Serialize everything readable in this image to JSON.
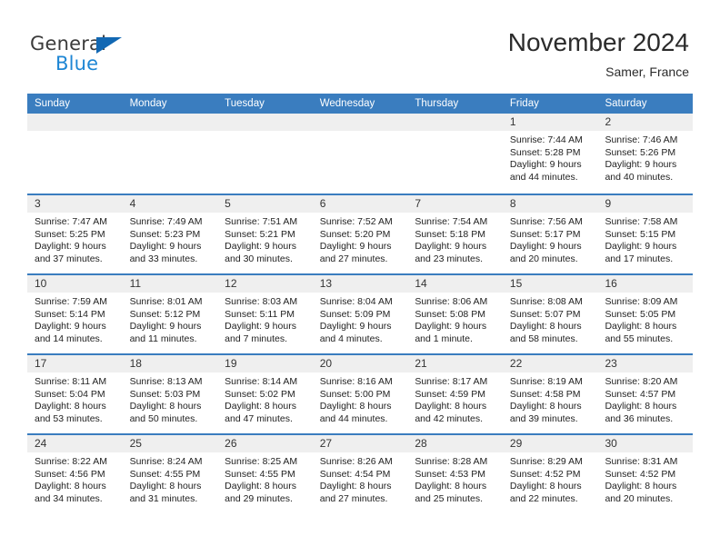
{
  "brand": {
    "name_part1": "General",
    "name_part2": "Blue",
    "triangle_color": "#1268b3",
    "blue_color": "#1e86d4"
  },
  "header": {
    "month_title": "November 2024",
    "location": "Samer, France"
  },
  "theme": {
    "header_blue": "#3a7dbf",
    "daynum_band": "#efefef",
    "text": "#222222"
  },
  "weekdays": [
    "Sunday",
    "Monday",
    "Tuesday",
    "Wednesday",
    "Thursday",
    "Friday",
    "Saturday"
  ],
  "weeks": [
    [
      {
        "day": "",
        "lines": []
      },
      {
        "day": "",
        "lines": []
      },
      {
        "day": "",
        "lines": []
      },
      {
        "day": "",
        "lines": []
      },
      {
        "day": "",
        "lines": []
      },
      {
        "day": "1",
        "lines": [
          "Sunrise: 7:44 AM",
          "Sunset: 5:28 PM",
          "Daylight: 9 hours",
          "and 44 minutes."
        ]
      },
      {
        "day": "2",
        "lines": [
          "Sunrise: 7:46 AM",
          "Sunset: 5:26 PM",
          "Daylight: 9 hours",
          "and 40 minutes."
        ]
      }
    ],
    [
      {
        "day": "3",
        "lines": [
          "Sunrise: 7:47 AM",
          "Sunset: 5:25 PM",
          "Daylight: 9 hours",
          "and 37 minutes."
        ]
      },
      {
        "day": "4",
        "lines": [
          "Sunrise: 7:49 AM",
          "Sunset: 5:23 PM",
          "Daylight: 9 hours",
          "and 33 minutes."
        ]
      },
      {
        "day": "5",
        "lines": [
          "Sunrise: 7:51 AM",
          "Sunset: 5:21 PM",
          "Daylight: 9 hours",
          "and 30 minutes."
        ]
      },
      {
        "day": "6",
        "lines": [
          "Sunrise: 7:52 AM",
          "Sunset: 5:20 PM",
          "Daylight: 9 hours",
          "and 27 minutes."
        ]
      },
      {
        "day": "7",
        "lines": [
          "Sunrise: 7:54 AM",
          "Sunset: 5:18 PM",
          "Daylight: 9 hours",
          "and 23 minutes."
        ]
      },
      {
        "day": "8",
        "lines": [
          "Sunrise: 7:56 AM",
          "Sunset: 5:17 PM",
          "Daylight: 9 hours",
          "and 20 minutes."
        ]
      },
      {
        "day": "9",
        "lines": [
          "Sunrise: 7:58 AM",
          "Sunset: 5:15 PM",
          "Daylight: 9 hours",
          "and 17 minutes."
        ]
      }
    ],
    [
      {
        "day": "10",
        "lines": [
          "Sunrise: 7:59 AM",
          "Sunset: 5:14 PM",
          "Daylight: 9 hours",
          "and 14 minutes."
        ]
      },
      {
        "day": "11",
        "lines": [
          "Sunrise: 8:01 AM",
          "Sunset: 5:12 PM",
          "Daylight: 9 hours",
          "and 11 minutes."
        ]
      },
      {
        "day": "12",
        "lines": [
          "Sunrise: 8:03 AM",
          "Sunset: 5:11 PM",
          "Daylight: 9 hours",
          "and 7 minutes."
        ]
      },
      {
        "day": "13",
        "lines": [
          "Sunrise: 8:04 AM",
          "Sunset: 5:09 PM",
          "Daylight: 9 hours",
          "and 4 minutes."
        ]
      },
      {
        "day": "14",
        "lines": [
          "Sunrise: 8:06 AM",
          "Sunset: 5:08 PM",
          "Daylight: 9 hours",
          "and 1 minute."
        ]
      },
      {
        "day": "15",
        "lines": [
          "Sunrise: 8:08 AM",
          "Sunset: 5:07 PM",
          "Daylight: 8 hours",
          "and 58 minutes."
        ]
      },
      {
        "day": "16",
        "lines": [
          "Sunrise: 8:09 AM",
          "Sunset: 5:05 PM",
          "Daylight: 8 hours",
          "and 55 minutes."
        ]
      }
    ],
    [
      {
        "day": "17",
        "lines": [
          "Sunrise: 8:11 AM",
          "Sunset: 5:04 PM",
          "Daylight: 8 hours",
          "and 53 minutes."
        ]
      },
      {
        "day": "18",
        "lines": [
          "Sunrise: 8:13 AM",
          "Sunset: 5:03 PM",
          "Daylight: 8 hours",
          "and 50 minutes."
        ]
      },
      {
        "day": "19",
        "lines": [
          "Sunrise: 8:14 AM",
          "Sunset: 5:02 PM",
          "Daylight: 8 hours",
          "and 47 minutes."
        ]
      },
      {
        "day": "20",
        "lines": [
          "Sunrise: 8:16 AM",
          "Sunset: 5:00 PM",
          "Daylight: 8 hours",
          "and 44 minutes."
        ]
      },
      {
        "day": "21",
        "lines": [
          "Sunrise: 8:17 AM",
          "Sunset: 4:59 PM",
          "Daylight: 8 hours",
          "and 42 minutes."
        ]
      },
      {
        "day": "22",
        "lines": [
          "Sunrise: 8:19 AM",
          "Sunset: 4:58 PM",
          "Daylight: 8 hours",
          "and 39 minutes."
        ]
      },
      {
        "day": "23",
        "lines": [
          "Sunrise: 8:20 AM",
          "Sunset: 4:57 PM",
          "Daylight: 8 hours",
          "and 36 minutes."
        ]
      }
    ],
    [
      {
        "day": "24",
        "lines": [
          "Sunrise: 8:22 AM",
          "Sunset: 4:56 PM",
          "Daylight: 8 hours",
          "and 34 minutes."
        ]
      },
      {
        "day": "25",
        "lines": [
          "Sunrise: 8:24 AM",
          "Sunset: 4:55 PM",
          "Daylight: 8 hours",
          "and 31 minutes."
        ]
      },
      {
        "day": "26",
        "lines": [
          "Sunrise: 8:25 AM",
          "Sunset: 4:55 PM",
          "Daylight: 8 hours",
          "and 29 minutes."
        ]
      },
      {
        "day": "27",
        "lines": [
          "Sunrise: 8:26 AM",
          "Sunset: 4:54 PM",
          "Daylight: 8 hours",
          "and 27 minutes."
        ]
      },
      {
        "day": "28",
        "lines": [
          "Sunrise: 8:28 AM",
          "Sunset: 4:53 PM",
          "Daylight: 8 hours",
          "and 25 minutes."
        ]
      },
      {
        "day": "29",
        "lines": [
          "Sunrise: 8:29 AM",
          "Sunset: 4:52 PM",
          "Daylight: 8 hours",
          "and 22 minutes."
        ]
      },
      {
        "day": "30",
        "lines": [
          "Sunrise: 8:31 AM",
          "Sunset: 4:52 PM",
          "Daylight: 8 hours",
          "and 20 minutes."
        ]
      }
    ]
  ]
}
